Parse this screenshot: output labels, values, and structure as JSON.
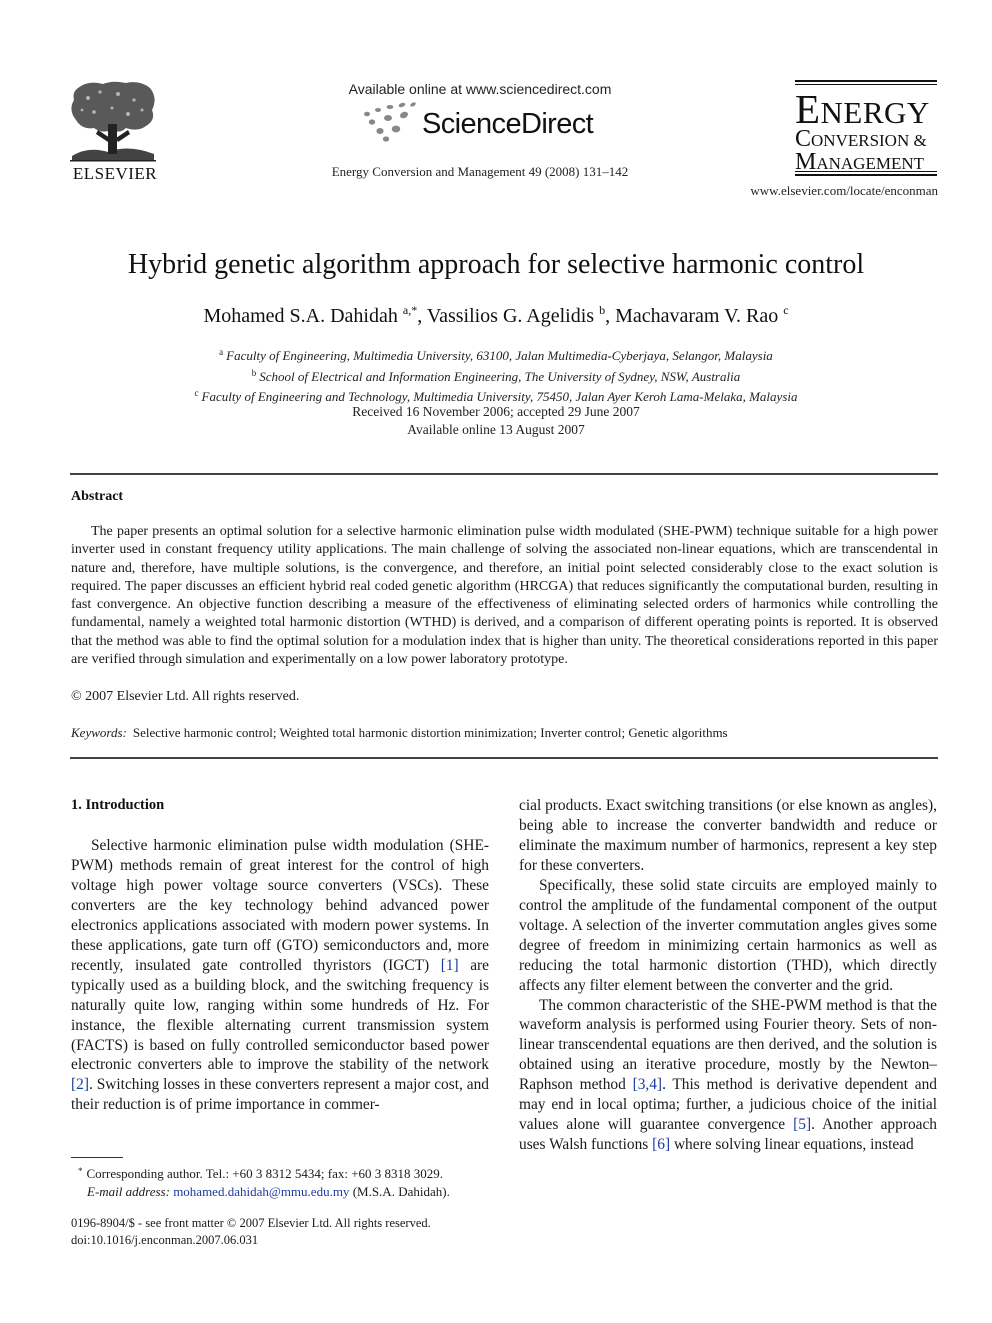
{
  "header": {
    "publisher_wordmark": "ELSEVIER",
    "available_online": "Available online at www.sciencedirect.com",
    "platform_name": "ScienceDirect",
    "journal_citation": "Energy Conversion and Management 49 (2008) 131–142",
    "journal_logo": {
      "line1_initial": "E",
      "line1_rest": "NERGY",
      "line2_initial": "C",
      "line2_rest": "ONVERSION &",
      "line3_initial": "M",
      "line3_rest": "ANAGEMENT"
    },
    "journal_url": "www.elsevier.com/locate/enconman"
  },
  "article": {
    "title": "Hybrid genetic algorithm approach for selective harmonic control",
    "authors": [
      {
        "name": "Mohamed S.A. Dahidah",
        "marks": "a,*"
      },
      {
        "name": "Vassilios G. Agelidis",
        "marks": "b"
      },
      {
        "name": "Machavaram V. Rao",
        "marks": "c"
      }
    ],
    "affiliations": [
      {
        "mark": "a",
        "text": "Faculty of Engineering, Multimedia University, 63100, Jalan Multimedia-Cyberjaya, Selangor, Malaysia"
      },
      {
        "mark": "b",
        "text": "School of Electrical and Information Engineering, The University of Sydney, NSW, Australia"
      },
      {
        "mark": "c",
        "text": "Faculty of Engineering and Technology, Multimedia University, 75450, Jalan Ayer Keroh Lama-Melaka, Malaysia"
      }
    ],
    "received": "Received 16 November 2006; accepted 29 June 2007",
    "available": "Available online 13 August 2007"
  },
  "abstract": {
    "heading": "Abstract",
    "text": "The paper presents an optimal solution for a selective harmonic elimination pulse width modulated (SHE-PWM) technique suitable for a high power inverter used in constant frequency utility applications. The main challenge of solving the associated non-linear equations, which are transcendental in nature and, therefore, have multiple solutions, is the convergence, and therefore, an initial point selected considerably close to the exact solution is required. The paper discusses an efficient hybrid real coded genetic algorithm (HRCGA) that reduces significantly the computational burden, resulting in fast convergence. An objective function describing a measure of the effectiveness of eliminating selected orders of harmonics while controlling the fundamental, namely a weighted total harmonic distortion (WTHD) is derived, and a comparison of different operating points is reported. It is observed that the method was able to find the optimal solution for a modulation index that is higher than unity. The theoretical considerations reported in this paper are verified through simulation and experimentally on a low power laboratory prototype.",
    "copyright": "© 2007 Elsevier Ltd. All rights reserved."
  },
  "keywords": {
    "label": "Keywords:",
    "text": "Selective harmonic control; Weighted total harmonic distortion minimization; Inverter control; Genetic algorithms"
  },
  "intro": {
    "heading": "1. Introduction",
    "left": {
      "p1_a": "Selective harmonic elimination pulse width modulation (SHE-PWM) methods remain of great interest for the control of high voltage high power voltage source converters (VSCs). These converters are the key technology behind advanced power electronics applications associated with modern power systems. In these applications, gate turn off (GTO) semiconductors and, more recently, insulated gate controlled thyristors (IGCT) ",
      "ref1": "[1]",
      "p1_b": " are typically used as a building block, and the switching frequency is naturally quite low, ranging within some hundreds of Hz. For instance, the flexible alternating current transmission system (FACTS) is based on fully controlled semiconductor based power electronic converters able to improve the stability of the network ",
      "ref2": "[2]",
      "p1_c": ". Switching losses in these converters represent a major cost, and their reduction is of prime importance in commer-"
    },
    "right": {
      "p1": "cial products. Exact switching transitions (or else known as angles), being able to increase the converter bandwidth and reduce or eliminate the maximum number of harmonics, represent a key step for these converters.",
      "p2": "Specifically, these solid state circuits are employed mainly to control the amplitude of the fundamental component of the output voltage. A selection of the inverter commutation angles gives some degree of freedom in minimizing certain harmonics as well as reducing the total harmonic distortion (THD), which directly affects any filter element between the converter and the grid.",
      "p3_a": "The common characteristic of the SHE-PWM method is that the waveform analysis is performed using Fourier theory. Sets of non-linear transcendental equations are then derived, and the solution is obtained using an iterative procedure, mostly by the Newton–Raphson method ",
      "ref34": "[3,4]",
      "p3_b": ". This method is derivative dependent and may end in local optima; further, a judicious choice of the initial values alone will guarantee convergence ",
      "ref5": "[5]",
      "p3_c": ". Another approach uses Walsh functions ",
      "ref6": "[6]",
      "p3_d": " where solving linear equations, instead"
    }
  },
  "footnote": {
    "mark": "*",
    "text": "Corresponding author. Tel.: +60 3 8312 5434; fax: +60 3 8318 3029.",
    "email_label": "E-mail address:",
    "email": "mohamed.dahidah@mmu.edu.my",
    "email_suffix": " (M.S.A. Dahidah)."
  },
  "front_matter": {
    "issn_line": "0196-8904/$ - see front matter © 2007 Elsevier Ltd. All rights reserved.",
    "doi": "doi:10.1016/j.enconman.2007.06.031"
  },
  "colors": {
    "link": "#1c3aa0",
    "text": "#1a1a1a",
    "rule": "#444444"
  }
}
